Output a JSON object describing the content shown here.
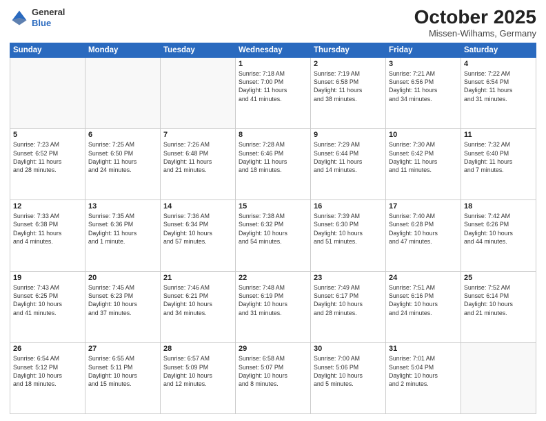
{
  "logo": {
    "general": "General",
    "blue": "Blue"
  },
  "header": {
    "month": "October 2025",
    "location": "Missen-Wilhams, Germany"
  },
  "weekdays": [
    "Sunday",
    "Monday",
    "Tuesday",
    "Wednesday",
    "Thursday",
    "Friday",
    "Saturday"
  ],
  "weeks": [
    [
      {
        "day": "",
        "info": ""
      },
      {
        "day": "",
        "info": ""
      },
      {
        "day": "",
        "info": ""
      },
      {
        "day": "1",
        "info": "Sunrise: 7:18 AM\nSunset: 7:00 PM\nDaylight: 11 hours\nand 41 minutes."
      },
      {
        "day": "2",
        "info": "Sunrise: 7:19 AM\nSunset: 6:58 PM\nDaylight: 11 hours\nand 38 minutes."
      },
      {
        "day": "3",
        "info": "Sunrise: 7:21 AM\nSunset: 6:56 PM\nDaylight: 11 hours\nand 34 minutes."
      },
      {
        "day": "4",
        "info": "Sunrise: 7:22 AM\nSunset: 6:54 PM\nDaylight: 11 hours\nand 31 minutes."
      }
    ],
    [
      {
        "day": "5",
        "info": "Sunrise: 7:23 AM\nSunset: 6:52 PM\nDaylight: 11 hours\nand 28 minutes."
      },
      {
        "day": "6",
        "info": "Sunrise: 7:25 AM\nSunset: 6:50 PM\nDaylight: 11 hours\nand 24 minutes."
      },
      {
        "day": "7",
        "info": "Sunrise: 7:26 AM\nSunset: 6:48 PM\nDaylight: 11 hours\nand 21 minutes."
      },
      {
        "day": "8",
        "info": "Sunrise: 7:28 AM\nSunset: 6:46 PM\nDaylight: 11 hours\nand 18 minutes."
      },
      {
        "day": "9",
        "info": "Sunrise: 7:29 AM\nSunset: 6:44 PM\nDaylight: 11 hours\nand 14 minutes."
      },
      {
        "day": "10",
        "info": "Sunrise: 7:30 AM\nSunset: 6:42 PM\nDaylight: 11 hours\nand 11 minutes."
      },
      {
        "day": "11",
        "info": "Sunrise: 7:32 AM\nSunset: 6:40 PM\nDaylight: 11 hours\nand 7 minutes."
      }
    ],
    [
      {
        "day": "12",
        "info": "Sunrise: 7:33 AM\nSunset: 6:38 PM\nDaylight: 11 hours\nand 4 minutes."
      },
      {
        "day": "13",
        "info": "Sunrise: 7:35 AM\nSunset: 6:36 PM\nDaylight: 11 hours\nand 1 minute."
      },
      {
        "day": "14",
        "info": "Sunrise: 7:36 AM\nSunset: 6:34 PM\nDaylight: 10 hours\nand 57 minutes."
      },
      {
        "day": "15",
        "info": "Sunrise: 7:38 AM\nSunset: 6:32 PM\nDaylight: 10 hours\nand 54 minutes."
      },
      {
        "day": "16",
        "info": "Sunrise: 7:39 AM\nSunset: 6:30 PM\nDaylight: 10 hours\nand 51 minutes."
      },
      {
        "day": "17",
        "info": "Sunrise: 7:40 AM\nSunset: 6:28 PM\nDaylight: 10 hours\nand 47 minutes."
      },
      {
        "day": "18",
        "info": "Sunrise: 7:42 AM\nSunset: 6:26 PM\nDaylight: 10 hours\nand 44 minutes."
      }
    ],
    [
      {
        "day": "19",
        "info": "Sunrise: 7:43 AM\nSunset: 6:25 PM\nDaylight: 10 hours\nand 41 minutes."
      },
      {
        "day": "20",
        "info": "Sunrise: 7:45 AM\nSunset: 6:23 PM\nDaylight: 10 hours\nand 37 minutes."
      },
      {
        "day": "21",
        "info": "Sunrise: 7:46 AM\nSunset: 6:21 PM\nDaylight: 10 hours\nand 34 minutes."
      },
      {
        "day": "22",
        "info": "Sunrise: 7:48 AM\nSunset: 6:19 PM\nDaylight: 10 hours\nand 31 minutes."
      },
      {
        "day": "23",
        "info": "Sunrise: 7:49 AM\nSunset: 6:17 PM\nDaylight: 10 hours\nand 28 minutes."
      },
      {
        "day": "24",
        "info": "Sunrise: 7:51 AM\nSunset: 6:16 PM\nDaylight: 10 hours\nand 24 minutes."
      },
      {
        "day": "25",
        "info": "Sunrise: 7:52 AM\nSunset: 6:14 PM\nDaylight: 10 hours\nand 21 minutes."
      }
    ],
    [
      {
        "day": "26",
        "info": "Sunrise: 6:54 AM\nSunset: 5:12 PM\nDaylight: 10 hours\nand 18 minutes."
      },
      {
        "day": "27",
        "info": "Sunrise: 6:55 AM\nSunset: 5:11 PM\nDaylight: 10 hours\nand 15 minutes."
      },
      {
        "day": "28",
        "info": "Sunrise: 6:57 AM\nSunset: 5:09 PM\nDaylight: 10 hours\nand 12 minutes."
      },
      {
        "day": "29",
        "info": "Sunrise: 6:58 AM\nSunset: 5:07 PM\nDaylight: 10 hours\nand 8 minutes."
      },
      {
        "day": "30",
        "info": "Sunrise: 7:00 AM\nSunset: 5:06 PM\nDaylight: 10 hours\nand 5 minutes."
      },
      {
        "day": "31",
        "info": "Sunrise: 7:01 AM\nSunset: 5:04 PM\nDaylight: 10 hours\nand 2 minutes."
      },
      {
        "day": "",
        "info": ""
      }
    ]
  ]
}
